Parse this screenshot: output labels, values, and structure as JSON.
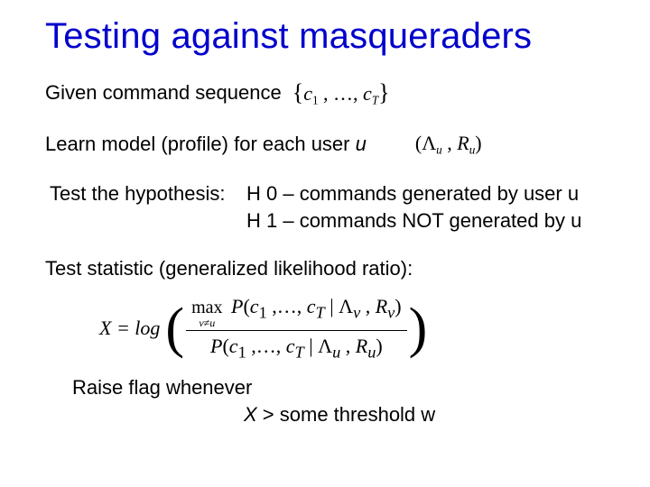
{
  "title": "Testing against masqueraders",
  "line1": "Given command sequence",
  "seq_math": "{c₁ , …, c_T}",
  "line2_a": "Learn model (profile) for each user ",
  "line2_u": "u",
  "model_math": "(Λ_u , R_u)",
  "hyp_intro": "Test the hypothesis:",
  "h0": "H 0 – commands generated by user u",
  "h1": "H 1 – commands NOT generated by u",
  "stat_label": "Test statistic (generalized likelihood ratio):",
  "eq_left": "X = log",
  "eq_max_op": "max",
  "eq_max_cond": "v≠u",
  "eq_num_p": "P(c₁ ,…, c_T | Λ_v , R_v)",
  "eq_den_p": "P(c₁ ,…, c_T | Λ_u , R_u)",
  "flag1": "Raise flag whenever",
  "flag2_x": "X",
  "flag2_rest": " > some threshold w"
}
